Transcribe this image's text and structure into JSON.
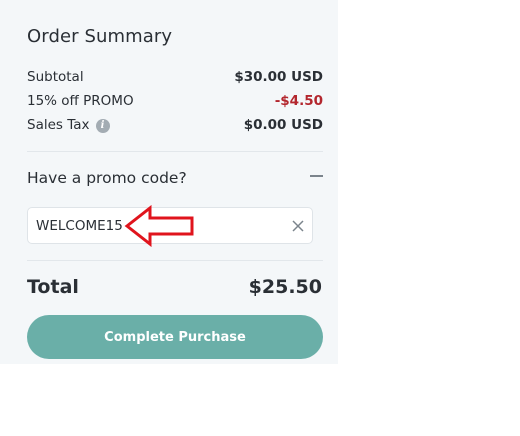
{
  "order_summary": {
    "title": "Order Summary",
    "subtotal": {
      "label": "Subtotal",
      "value": "$30.00 USD"
    },
    "promo": {
      "label": "15% off PROMO",
      "value": "-$4.50",
      "color": "#b3262d"
    },
    "sales_tax": {
      "label": "Sales Tax",
      "value": "$0.00 USD",
      "icon": "info-icon"
    }
  },
  "promo_code": {
    "heading": "Have a promo code?",
    "toggle_icon": "minus-icon",
    "input_value": "WELCOME15",
    "clear_icon": "close-icon",
    "annotation": "red-arrow-pointing-left"
  },
  "total": {
    "label": "Total",
    "value": "$25.50"
  },
  "checkout": {
    "button_label": "Complete Purchase",
    "button_color": "#6aafa8"
  }
}
